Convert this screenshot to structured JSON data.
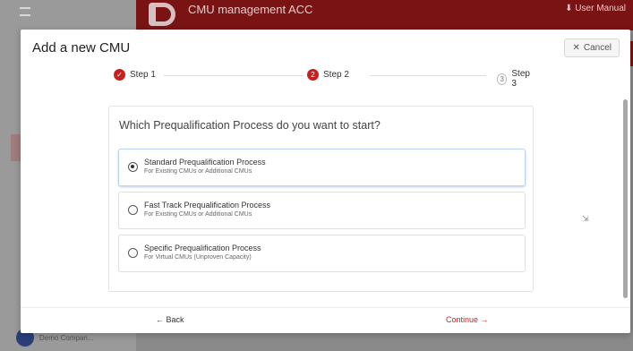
{
  "background": {
    "app_title": "CMU management ACC",
    "user_manual": "User Manual",
    "user_name": "Demo Compan..."
  },
  "dialog": {
    "title": "Add a new CMU",
    "cancel_label": "Cancel",
    "steps": [
      {
        "label": "Step 1",
        "state": "done",
        "marker": "✓"
      },
      {
        "label": "Step 2",
        "state": "active",
        "marker": "2"
      },
      {
        "label": "Step 3",
        "state": "pending",
        "marker": "3"
      }
    ],
    "question": "Which Prequalification Process do you want to start?",
    "options": [
      {
        "title": "Standard Prequalification Process",
        "subtitle": "For Existing CMUs or Additional CMUs",
        "selected": true
      },
      {
        "title": "Fast Track Prequalification Process",
        "subtitle": "For Existing CMUs or Additional CMUs",
        "selected": false
      },
      {
        "title": "Specific Prequalification Process",
        "subtitle": "For Virtual CMUs (Unproven Capacity)",
        "selected": false
      }
    ],
    "back_label": "Back",
    "continue_label": "Continue"
  },
  "colors": {
    "accent": "#c81f1f",
    "header_bg": "#7a1414"
  }
}
